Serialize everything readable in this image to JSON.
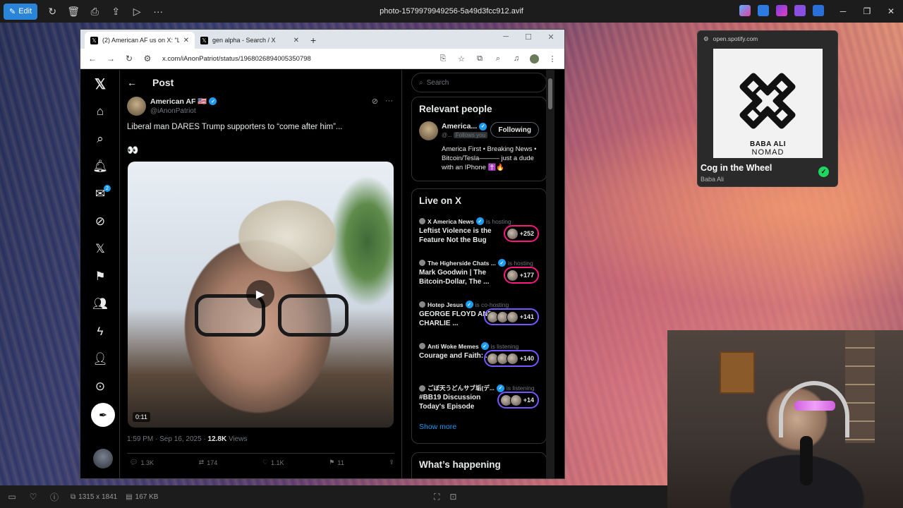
{
  "viewer": {
    "edit_label": "Edit",
    "file_title": "photo-1579979949256-5a49d3fcc912.avif",
    "dimensions": "1315 x 1841",
    "file_size": "167 KB"
  },
  "browser": {
    "tabs": [
      {
        "label": "(2) American AF us on X: \"Liberal",
        "active": true
      },
      {
        "label": "gen alpha - Search / X",
        "active": false
      }
    ],
    "url": "x.com/iAnonPatriot/status/1968026894005350798"
  },
  "x": {
    "header_title": "Post",
    "messages_badge": "2",
    "author_name": "American AF 🇺🇸",
    "author_handle": "@iAnonPatriot",
    "post_text": "Liberal man DARES Trump supporters to “come after him”...",
    "emoji": "👀",
    "video_duration": "0:11",
    "post_time": "1:59 PM · Sep 16, 2025 · ",
    "views_count": "12.8K",
    "views_label": " Views",
    "actions": {
      "replies": "1.3K",
      "reposts": "174",
      "likes": "1.1K",
      "bookmarks": "11"
    },
    "search_placeholder": "Search",
    "relevant_people_title": "Relevant people",
    "relevant_person": {
      "name": "America...",
      "handle": "@...",
      "follows_you": "Follows you",
      "button": "Following",
      "bio": "America First • Breaking News • Bitcoin/Tesla——— just a dude with an IPhone ✝️🔥"
    },
    "live_title": "Live on X",
    "spaces": [
      {
        "host": "X America News",
        "role": "is hosting",
        "title": "Leftist Violence is the Feature Not the Bug",
        "count": "+252",
        "color": "pink"
      },
      {
        "host": "The Higherside Chats ...",
        "role": "is hosting",
        "title": "Mark Goodwin | The Bitcoin-Dollar, The ...",
        "count": "+177",
        "color": "pink"
      },
      {
        "host": "Hotep Jesus",
        "role": "is co-hosting",
        "title": "GEORGE FLOYD AND CHARLIE ...",
        "count": "+141",
        "color": "purple"
      },
      {
        "host": "Anti Woke Memes",
        "role": "is listening",
        "title": "Courage and Faith: ...",
        "count": "+140",
        "color": "purple"
      },
      {
        "host": "ごぼ天うどんサブ垢(デ...",
        "role": "is listening",
        "title": "#BB19 Discussion Today's Episode",
        "count": "+14",
        "color": "purple"
      }
    ],
    "show_more": "Show more",
    "whats_happening": "What’s happening"
  },
  "spotify": {
    "url": "open.spotify.com",
    "art_line1": "BABA ALI",
    "art_line2": "NOMAD",
    "track": "Cog in the Wheel",
    "artist": "Baba Ali"
  },
  "colors": {
    "x_blue": "#1d9bf0",
    "spotify_green": "#1ed760",
    "edit_blue": "#2a84d8"
  }
}
